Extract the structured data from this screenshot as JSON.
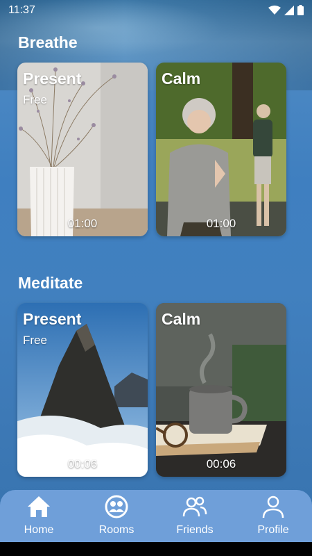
{
  "status_bar": {
    "time": "11:37"
  },
  "sections": [
    {
      "title": "Breathe",
      "cards": [
        {
          "title": "Present",
          "subtitle": "Free",
          "duration": "01:00"
        },
        {
          "title": "Calm",
          "subtitle": "",
          "duration": "01:00"
        }
      ]
    },
    {
      "title": "Meditate",
      "cards": [
        {
          "title": "Present",
          "subtitle": "Free",
          "duration": "00:06"
        },
        {
          "title": "Calm",
          "subtitle": "",
          "duration": "00:06"
        }
      ]
    }
  ],
  "bottom_nav": {
    "items": [
      {
        "label": "Home",
        "icon": "home-icon"
      },
      {
        "label": "Rooms",
        "icon": "rooms-icon"
      },
      {
        "label": "Friends",
        "icon": "friends-icon"
      },
      {
        "label": "Profile",
        "icon": "profile-icon"
      }
    ]
  },
  "colors": {
    "nav_bar": "#6f9fd9",
    "background": "#4180bf",
    "text": "#ffffff"
  }
}
